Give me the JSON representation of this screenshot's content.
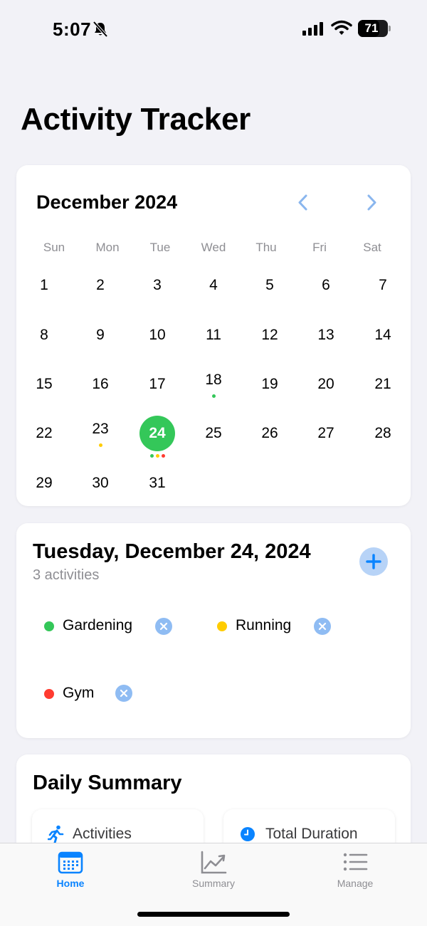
{
  "status_bar": {
    "time": "5:07",
    "battery_level": 71,
    "battery_text": "71"
  },
  "app": {
    "title": "Activity Tracker"
  },
  "calendar": {
    "month_label": "December 2024",
    "weekdays": [
      "Sun",
      "Mon",
      "Tue",
      "Wed",
      "Thu",
      "Fri",
      "Sat"
    ],
    "days": [
      [
        "1",
        "2",
        "3",
        "4",
        "5",
        "6",
        "7"
      ],
      [
        "8",
        "9",
        "10",
        "11",
        "12",
        "13",
        "14"
      ],
      [
        "15",
        "16",
        "17",
        "18",
        "19",
        "20",
        "21"
      ],
      [
        "22",
        "23",
        "24",
        "25",
        "26",
        "27",
        "28"
      ],
      [
        "29",
        "30",
        "31"
      ]
    ],
    "selected_day": "24",
    "markers": {
      "18": [
        "#34c759"
      ],
      "23": [
        "#ffcc00"
      ],
      "24": [
        "#34c759",
        "#ffcc00",
        "#ff3b30"
      ]
    }
  },
  "day_detail": {
    "title": "Tuesday, December 24, 2024",
    "subtitle": "3 activities",
    "activities": [
      {
        "label": "Gardening",
        "color": "#34c759"
      },
      {
        "label": "Running",
        "color": "#ffcc00"
      },
      {
        "label": "Gym",
        "color": "#ff3b30"
      }
    ]
  },
  "summary": {
    "title": "Daily Summary",
    "stats": [
      {
        "label": "Activities",
        "icon": "runner-icon"
      },
      {
        "label": "Total Duration",
        "icon": "clock-icon"
      }
    ]
  },
  "tabs": [
    {
      "label": "Home",
      "icon": "calendar-icon",
      "active": true
    },
    {
      "label": "Summary",
      "icon": "chart-icon",
      "active": false
    },
    {
      "label": "Manage",
      "icon": "list-icon",
      "active": false
    }
  ],
  "colors": {
    "accent": "#0a84ff",
    "selected_day": "#34c759",
    "background": "#f2f2f7"
  }
}
